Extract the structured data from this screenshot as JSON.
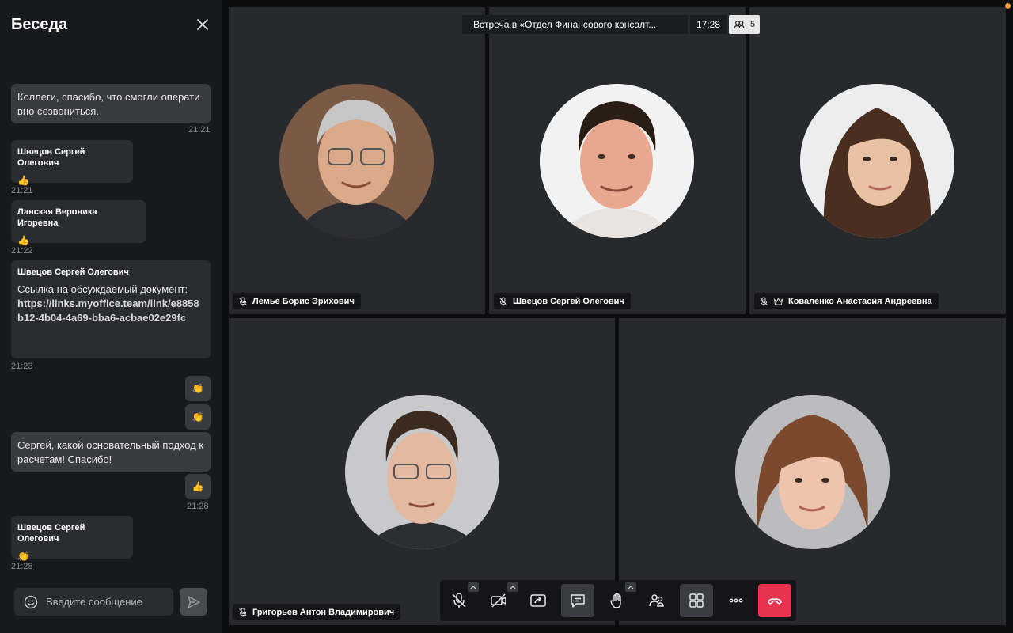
{
  "chat": {
    "title": "Беседа",
    "messages": [
      {
        "type": "outgoing",
        "text": "Коллеги, спасибо, что смогли оперативно созвониться.",
        "time": "21:21"
      },
      {
        "type": "incoming",
        "author": "Швецов Сергей Олегович",
        "emoji": "👍",
        "time": "21:21"
      },
      {
        "type": "incoming",
        "author": "Ланская Вероника Игоревна",
        "emoji": "👍",
        "time": "21:22"
      },
      {
        "type": "incoming",
        "author": "Швецов Сергей Олегович",
        "text": "Ссылка на обсуждаемый документ:",
        "link": "https://links.myoffice.team/link/e8858b12-4b04-4a69-bba6-acbae02e29fc",
        "time": "21:23"
      },
      {
        "type": "outgoing-emoji",
        "emoji": "👏"
      },
      {
        "type": "outgoing-emoji",
        "emoji": "👏"
      },
      {
        "type": "outgoing",
        "text": "Сергей, какой основательный подход к расчетам! Спасибо!"
      },
      {
        "type": "outgoing-emoji",
        "emoji": "👍",
        "time": "21:28"
      },
      {
        "type": "incoming",
        "author": "Швецов Сергей Олегович",
        "emoji": "👏",
        "time": "21:28"
      }
    ],
    "composer_placeholder": "Введите сообщение"
  },
  "meeting": {
    "title": "Встреча в «Отдел Финансового консалт...",
    "time": "17:28",
    "participants_count": "5"
  },
  "participants": [
    {
      "name": "Лемье Борис Эрихович",
      "muted": true,
      "host": false,
      "skin": "#d9a98a",
      "hair": "#c7c7c7",
      "bg": "#7a5a45"
    },
    {
      "name": "Швецов Сергей Олегович",
      "muted": true,
      "host": false,
      "skin": "#e7a88f",
      "hair": "#2a1d16",
      "bg": "#f2f2f2"
    },
    {
      "name": "Коваленко Анастасия Андреевна",
      "muted": true,
      "host": true,
      "skin": "#e9c2a6",
      "hair": "#4a2f20",
      "bg": "#ededee"
    },
    {
      "name": "Григорьев Антон Владимирович",
      "muted": true,
      "host": false,
      "skin": "#e4b9a1",
      "hair": "#3a2a20",
      "bg": "#c9c9cb"
    },
    {
      "name": "",
      "muted": false,
      "host": false,
      "skin": "#eec4ad",
      "hair": "#7b4a2e",
      "bg": "#bcbcbf"
    }
  ],
  "toolbar": {
    "buttons": [
      "microphone",
      "camera",
      "screen-share",
      "chat",
      "raise-hand",
      "participants",
      "layout",
      "more",
      "hang-up"
    ]
  },
  "colors": {
    "hangup": "#e8334f",
    "status_dot": "#f29b3a"
  }
}
